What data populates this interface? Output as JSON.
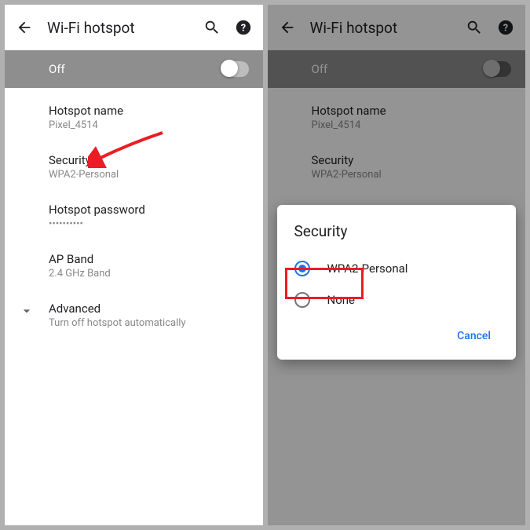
{
  "left": {
    "title": "Wi-Fi hotspot",
    "toggle_label": "Off",
    "rows": {
      "hotspot_name": {
        "title": "Hotspot name",
        "value": "Pixel_4514"
      },
      "security": {
        "title": "Security",
        "value": "WPA2-Personal"
      },
      "password": {
        "title": "Hotspot password",
        "value": "••••••••••"
      },
      "ap_band": {
        "title": "AP Band",
        "value": "2.4 GHz Band"
      },
      "advanced": {
        "title": "Advanced",
        "value": "Turn off hotspot automatically"
      }
    }
  },
  "right": {
    "title": "Wi-Fi hotspot",
    "toggle_label": "Off",
    "rows": {
      "hotspot_name": {
        "title": "Hotspot name",
        "value": "Pixel_4514"
      },
      "security": {
        "title": "Security",
        "value": "WPA2-Personal"
      }
    },
    "dialog": {
      "title": "Security",
      "option1": "WPA2-Personal",
      "option2": "None",
      "cancel": "Cancel"
    }
  }
}
